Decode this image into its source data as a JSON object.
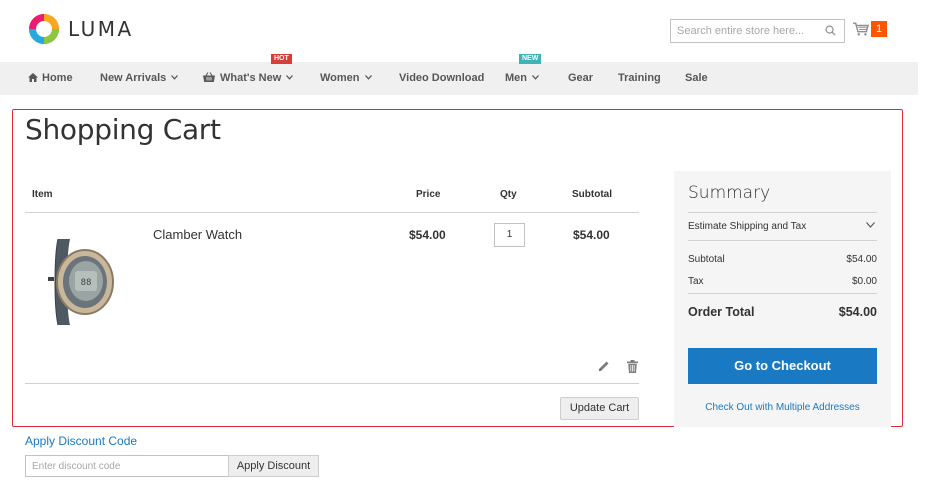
{
  "header": {
    "logo_text": "LUMA",
    "search_placeholder": "Search entire store here...",
    "cart_count": "1"
  },
  "nav": {
    "items": [
      {
        "label": "Home",
        "icon": "home-icon"
      },
      {
        "label": "New Arrivals",
        "has_dropdown": true
      },
      {
        "label": "What's New",
        "icon": "basket-icon",
        "has_dropdown": true,
        "badge": "HOT"
      },
      {
        "label": "Women",
        "has_dropdown": true
      },
      {
        "label": "Video Download"
      },
      {
        "label": "Men",
        "has_dropdown": true,
        "badge": "NEW"
      },
      {
        "label": "Gear"
      },
      {
        "label": "Training"
      },
      {
        "label": "Sale"
      }
    ]
  },
  "page": {
    "title": "Shopping Cart"
  },
  "cart": {
    "columns": [
      "Item",
      "Price",
      "Qty",
      "Subtotal"
    ],
    "items": [
      {
        "name": "Clamber Watch",
        "price": "$54.00",
        "qty": "1",
        "subtotal": "$54.00"
      }
    ],
    "update_label": "Update Cart"
  },
  "summary": {
    "title": "Summary",
    "estimate_label": "Estimate Shipping and Tax",
    "subtotal_label": "Subtotal",
    "subtotal_value": "$54.00",
    "tax_label": "Tax",
    "tax_value": "$0.00",
    "order_total_label": "Order Total",
    "order_total_value": "$54.00",
    "checkout_label": "Go to Checkout",
    "multi_address_label": "Check Out with Multiple Addresses"
  },
  "discount": {
    "link_label": "Apply Discount Code",
    "input_placeholder": "Enter discount code",
    "apply_label": "Apply Discount"
  },
  "colors": {
    "accent": "#1979c3",
    "cart_badge": "#ff5501",
    "hot_badge": "#d83d3a",
    "new_badge": "#40b3b6",
    "highlight_frame": "#e02b3c"
  }
}
